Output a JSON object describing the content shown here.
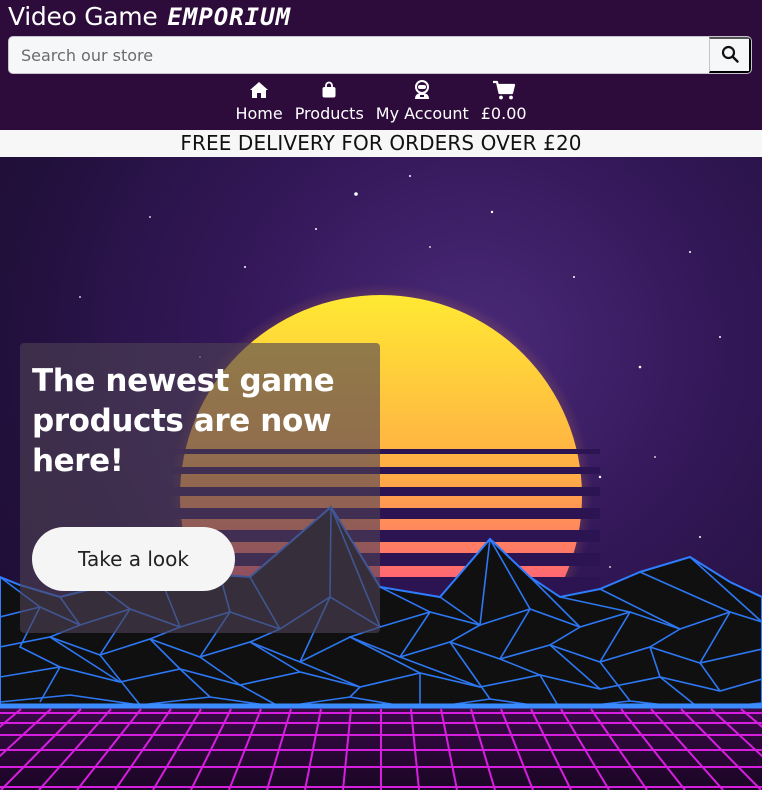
{
  "brand": {
    "name_main": "Video Game",
    "name_accent": "EMPORIUM"
  },
  "search": {
    "placeholder": "Search our store",
    "value": "",
    "button_icon": "search-icon"
  },
  "nav": {
    "items": [
      {
        "label": "Home",
        "icon": "home-icon"
      },
      {
        "label": "Products",
        "icon": "shopping-bag-icon"
      },
      {
        "label": "My Account",
        "icon": "astronaut-icon"
      },
      {
        "label": "£0.00",
        "icon": "cart-icon"
      }
    ]
  },
  "banner": {
    "text": "FREE DELIVERY FOR ORDERS OVER £20"
  },
  "hero": {
    "headline": "The newest game products are now here!",
    "cta_label": "Take a look"
  },
  "colors": {
    "header_bg": "#2d0c3b",
    "banner_bg": "#f7f7f7",
    "grid_magenta": "#e020e8",
    "mountain_blue": "#2f7dff",
    "sun_top": "#ffe633",
    "sun_bottom": "#ff2f8e"
  }
}
